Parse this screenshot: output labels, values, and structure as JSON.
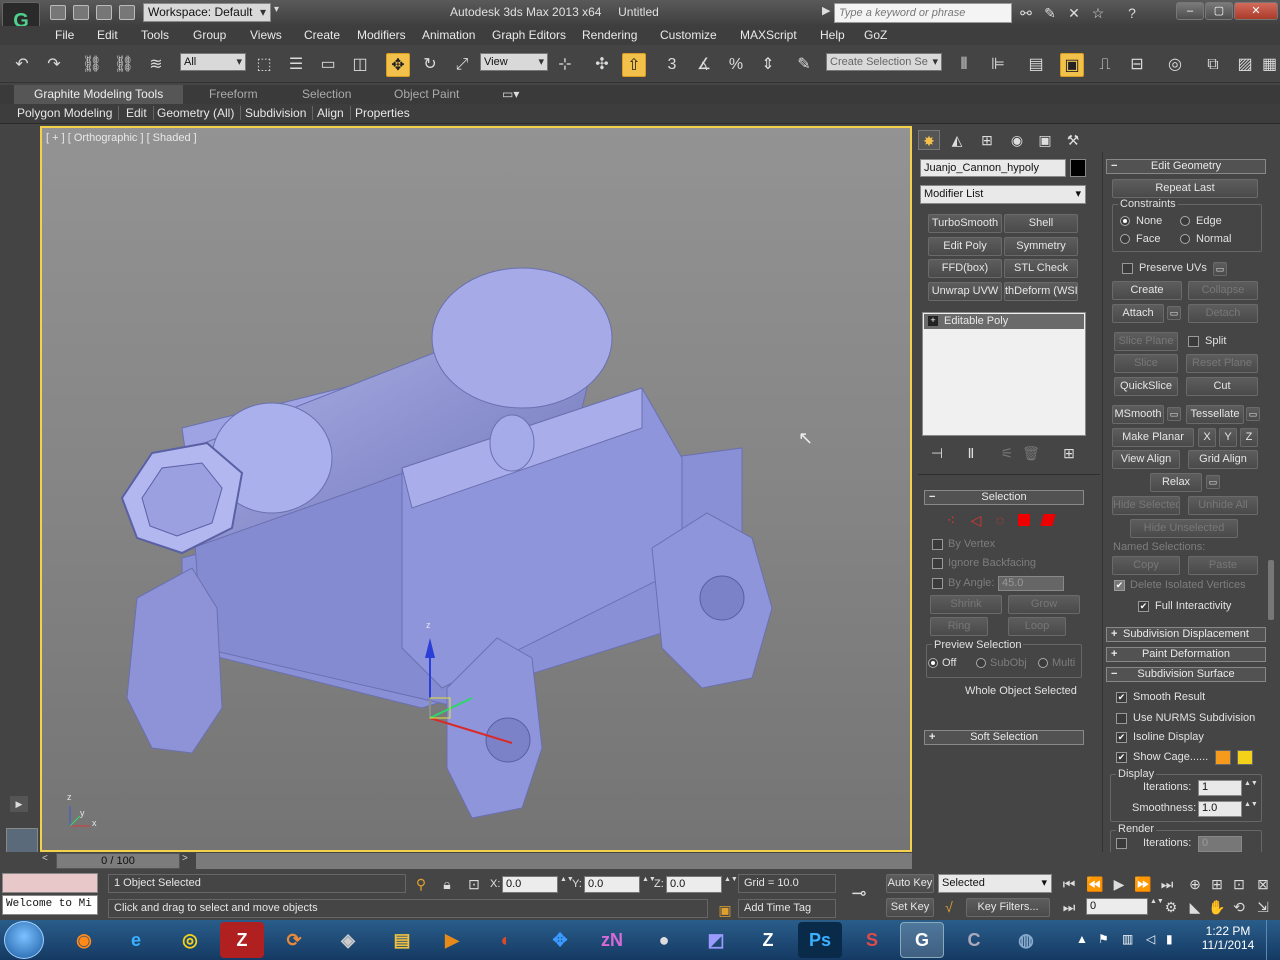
{
  "title_bar": {
    "workspace": "Workspace: Default",
    "app_title": "Autodesk 3ds Max  2013 x64",
    "doc_title": "Untitled",
    "search_placeholder": "Type a keyword or phrase"
  },
  "menu": [
    "File",
    "Edit",
    "Tools",
    "Group",
    "Views",
    "Create",
    "Modifiers",
    "Animation",
    "Graph Editors",
    "Rendering",
    "Customize",
    "MAXScript",
    "Help",
    "GoZ"
  ],
  "main_toolbar": {
    "filter": "All",
    "ref_coord": "View",
    "snap_value": "3",
    "selection_set_placeholder": "Create Selection Se"
  },
  "ribbon": {
    "tabs": [
      "Graphite Modeling Tools",
      "Freeform",
      "Selection",
      "Object Paint"
    ],
    "panels": [
      "Polygon Modeling",
      "Edit",
      "Geometry (All)",
      "Subdivision",
      "Align",
      "Properties"
    ]
  },
  "viewport": {
    "label": "[ + ] [ Orthographic ] [ Shaded ]",
    "gizmo_z": "z",
    "axis_x": "x",
    "axis_y": "y",
    "axis_z": "z"
  },
  "command_panel": {
    "object_name": "Juanjo_Cannon_hypoly",
    "modifier_list": "Modifier List",
    "modifier_buttons": [
      "TurboSmooth",
      "Shell",
      "Edit Poly",
      "Symmetry",
      "FFD(box)",
      "STL Check",
      "Unwrap UVW",
      "thDeform (WSI"
    ],
    "stack_item": "Editable Poly",
    "selection": {
      "header": "Selection",
      "by_vertex": "By Vertex",
      "ignore_backfacing": "Ignore Backfacing",
      "by_angle": "By Angle:",
      "angle_value": "45.0",
      "shrink": "Shrink",
      "grow": "Grow",
      "ring": "Ring",
      "loop": "Loop",
      "preview_selection": "Preview Selection",
      "off": "Off",
      "subobj": "SubObj",
      "multi": "Multi",
      "status": "Whole Object Selected"
    },
    "soft_selection": "Soft Selection"
  },
  "edit_geometry": {
    "header": "Edit Geometry",
    "repeat_last": "Repeat Last",
    "constraints": "Constraints",
    "none": "None",
    "edge": "Edge",
    "face": "Face",
    "normal": "Normal",
    "preserve_uvs": "Preserve UVs",
    "create": "Create",
    "collapse": "Collapse",
    "attach": "Attach",
    "detach": "Detach",
    "slice_plane": "Slice Plane",
    "split": "Split",
    "slice": "Slice",
    "reset_plane": "Reset Plane",
    "quickslice": "QuickSlice",
    "cut": "Cut",
    "msmooth": "MSmooth",
    "tessellate": "Tessellate",
    "make_planar": "Make Planar",
    "x": "X",
    "y": "Y",
    "z": "Z",
    "view_align": "View Align",
    "grid_align": "Grid Align",
    "relax": "Relax",
    "hide_selected": "Hide Selected",
    "unhide_all": "Unhide All",
    "hide_unselected": "Hide Unselected",
    "named_selections": "Named Selections:",
    "copy": "Copy",
    "paste": "Paste",
    "delete_isolated": "Delete Isolated Vertices",
    "full_interactivity": "Full Interactivity"
  },
  "rollouts": {
    "subdivision_displacement": "Subdivision Displacement",
    "paint_deformation": "Paint Deformation",
    "subdivision_surface": "Subdivision Surface",
    "smooth_result": "Smooth Result",
    "use_nurms": "Use NURMS Subdivision",
    "isoline_display": "Isoline Display",
    "show_cage": "Show Cage......",
    "display": "Display",
    "iterations_label": "Iterations:",
    "iterations_value": "1",
    "smoothness_label": "Smoothness:",
    "smoothness_value": "1.0",
    "render": "Render",
    "render_iterations_value": "0",
    "cage_color_1": "#f59a1a",
    "cage_color_2": "#f5d21a"
  },
  "status": {
    "time_slider": "0 / 100",
    "maxscript": "Welcome to Mi",
    "selected_count": "1 Object Selected",
    "prompt": "Click and drag to select and move objects",
    "x_label": "X:",
    "x": "0.0",
    "y_label": "Y:",
    "y": "0.0",
    "z_label": "Z:",
    "z": "0.0",
    "grid": "Grid = 10.0",
    "add_time_tag": "Add Time Tag",
    "auto_key": "Auto Key",
    "set_key": "Set Key",
    "key_mode": "Selected",
    "key_filters": "Key Filters...",
    "frame": "0"
  },
  "taskbar": {
    "time": "1:22 PM",
    "date": "11/1/2014"
  }
}
